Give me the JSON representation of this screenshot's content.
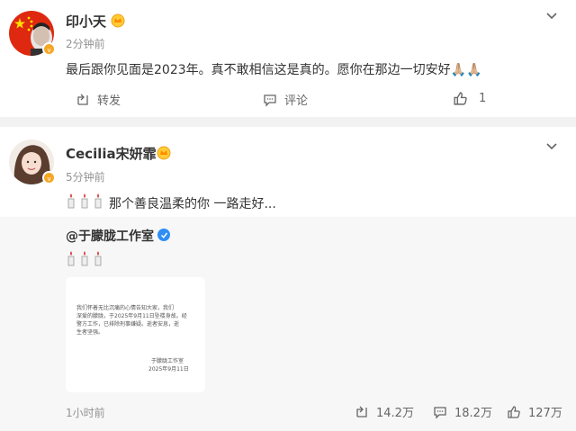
{
  "post1": {
    "username": "印小天",
    "time": "2分钟前",
    "text": "最后跟你见面是2023年。真不敢相信这是真的。愿你在那边一切安好🙏🏼🙏🏼",
    "repost_label": "转发",
    "comment_label": "评论",
    "like_count": "1"
  },
  "post2": {
    "username": "Cecilia宋妍霏",
    "time": "5分钟前",
    "text": "那个善良温柔的你 一路走好...",
    "repost": {
      "username": "@于朦胧工作室",
      "notice_lines": [
        "我们怀着无比沉痛的心情告知大家，我们",
        "深爱的朦胧，于2025年9月11日坠楼身故。经",
        "警方工作，已排除刑事嫌疑。逝者安息，逝",
        "生者坚强。"
      ],
      "notice_signature": "于朦胧工作室",
      "notice_date": "2025年9月11日",
      "time": "1小时前",
      "share_count": "14.2万",
      "comment_count": "18.2万",
      "like_count": "127万"
    }
  },
  "colors": {
    "accent_orange": "#f5a623",
    "verify_blue": "#2f8ef5",
    "muted_text": "#939393"
  }
}
